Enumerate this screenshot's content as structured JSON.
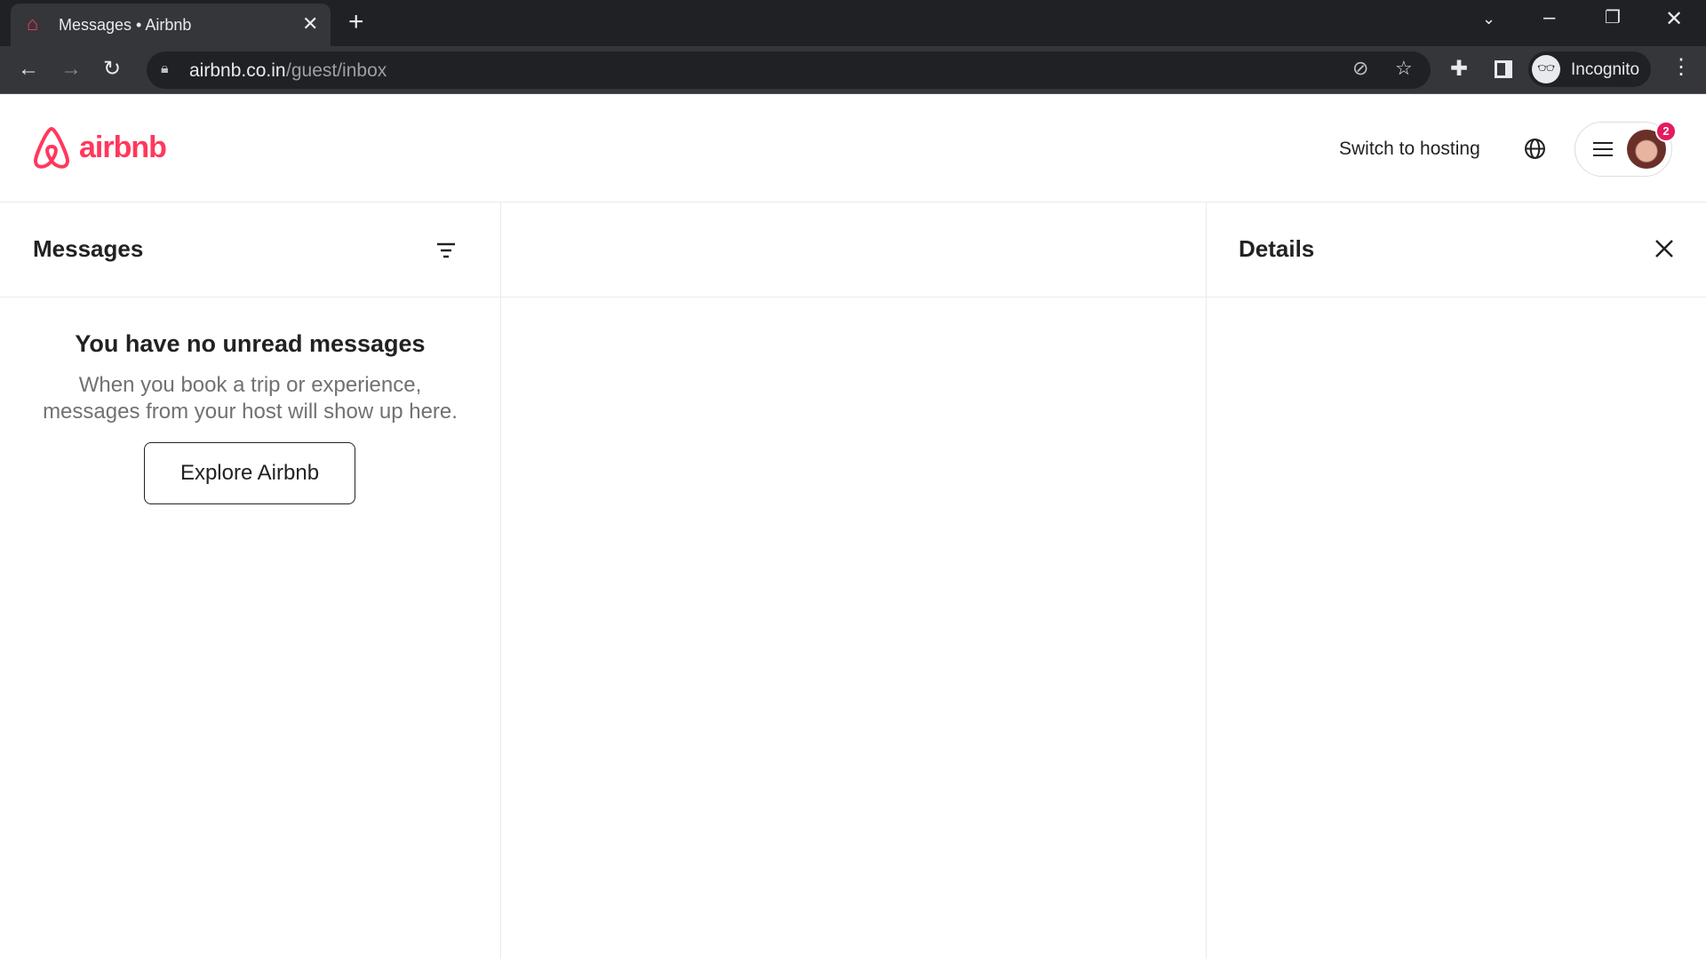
{
  "browser": {
    "tab_title": "Messages • Airbnb",
    "url_domain": "airbnb.co.in",
    "url_path": "/guest/inbox",
    "profile_label": "Incognito"
  },
  "header": {
    "logo_text": "airbnb",
    "switch_hosting": "Switch to hosting",
    "notification_count": "2",
    "brand_color": "#ff385c"
  },
  "messages": {
    "title": "Messages",
    "empty_title": "You have no unread messages",
    "empty_line1": "When you book a trip or experience,",
    "empty_line2": "messages from your host will show up here.",
    "explore_button": "Explore Airbnb"
  },
  "details": {
    "title": "Details"
  }
}
